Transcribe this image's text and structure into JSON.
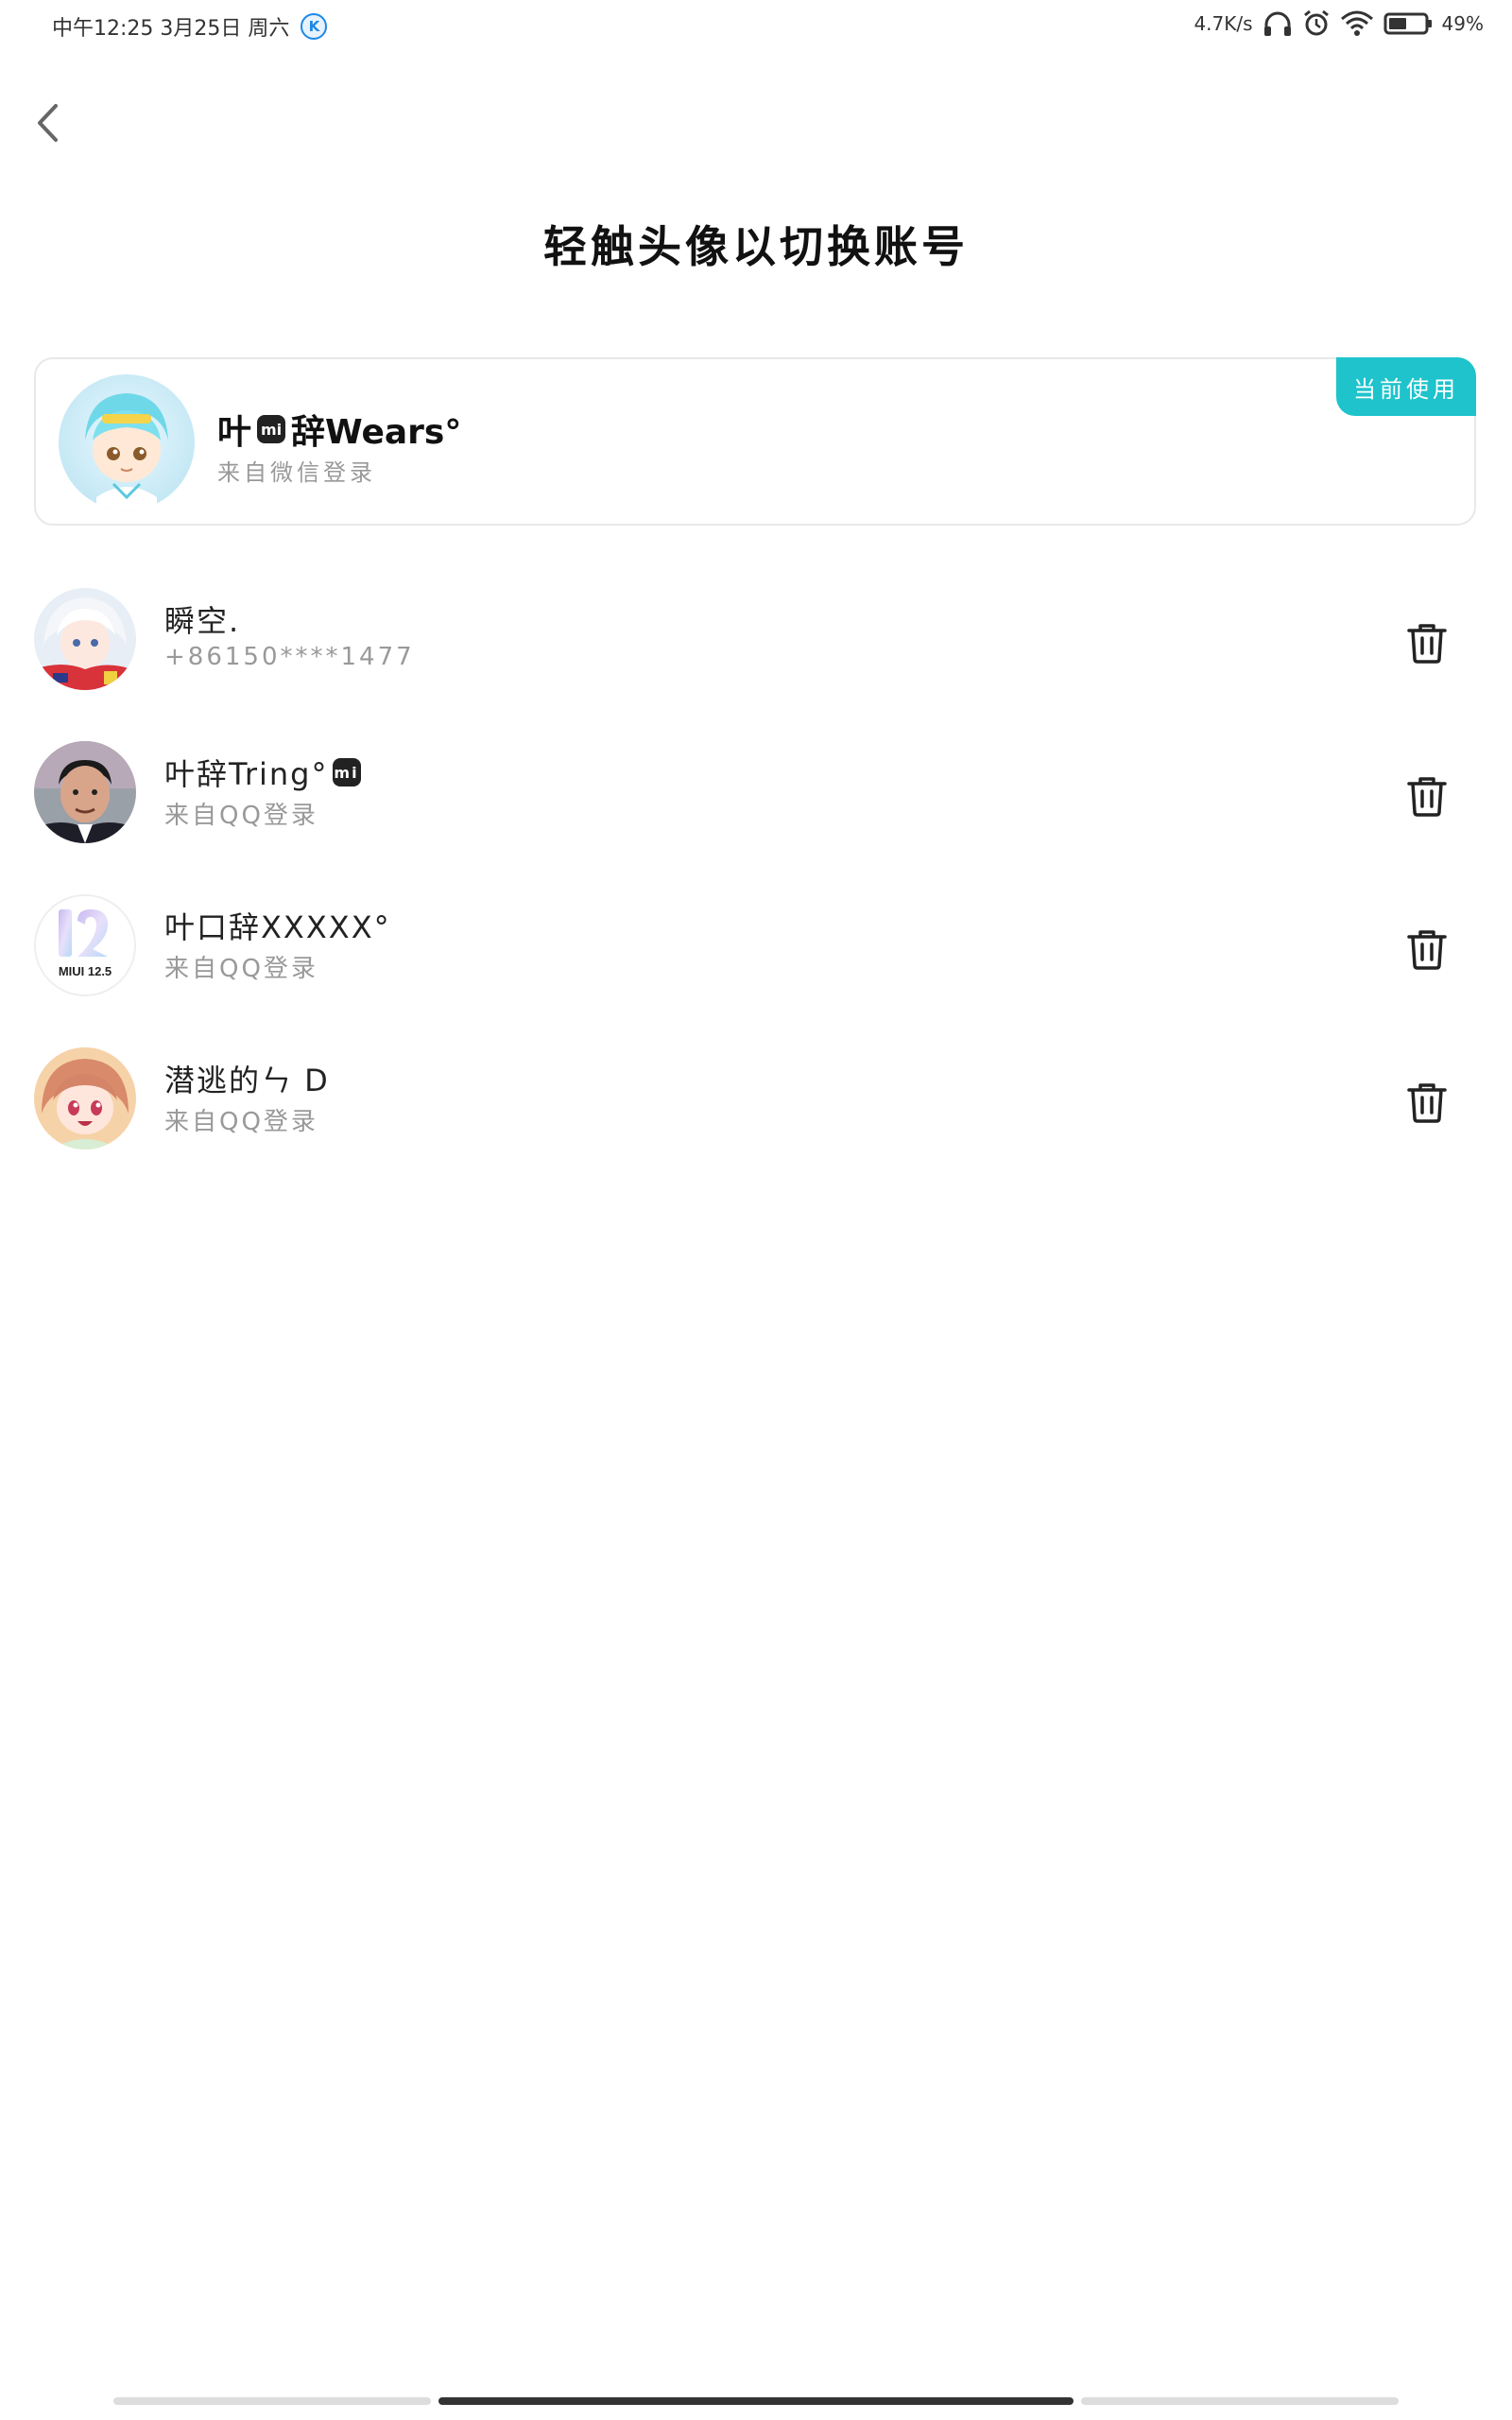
{
  "status_bar": {
    "time_date": "中午12:25 3月25日 周六",
    "k_icon_label": "K",
    "network_speed": "4.7K/s",
    "battery_percent": "49%"
  },
  "page": {
    "title": "轻触头像以切换账号"
  },
  "current_account": {
    "badge": "当前使用",
    "name_prefix": "叶",
    "mi_label": "mi",
    "name_suffix": "辞Wears°",
    "source": "来自微信登录"
  },
  "accounts": [
    {
      "name": "瞬空.",
      "sub": "+86150****1477",
      "mi": ""
    },
    {
      "name": "叶辞Tring°",
      "sub": "来自QQ登录",
      "mi": "mi"
    },
    {
      "name": "叶口辞XXXXX°",
      "sub": "来自QQ登录",
      "mi": ""
    },
    {
      "name": "潜逃的ㄣ D",
      "sub": "来自QQ登录",
      "mi": ""
    }
  ],
  "miui_avatar_label": "MIUI 12.5",
  "colors": {
    "accent": "#1ec3cc",
    "nav_active": "#333333",
    "nav_inactive": "#dddddd"
  }
}
